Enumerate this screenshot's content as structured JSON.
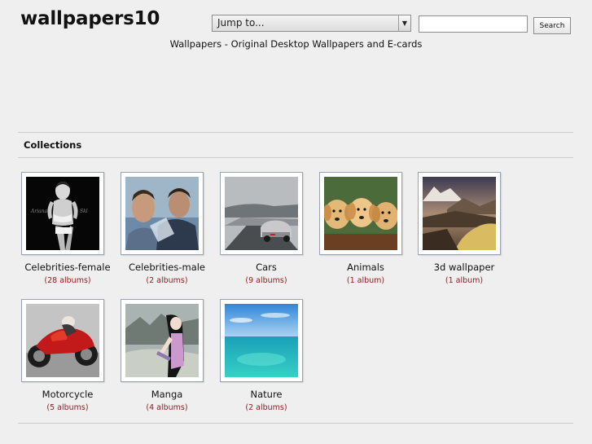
{
  "header": {
    "site_title": "wallpapers10",
    "jump_to": "Jump to...",
    "search_placeholder": "",
    "search_button": "Search",
    "tagline": "Wallpapers - Original Desktop Wallpapers and E-cards"
  },
  "collections": {
    "heading": "Collections",
    "items": [
      {
        "name": "Celebrities-female",
        "count": "(28 albums)"
      },
      {
        "name": "Celebrities-male",
        "count": "(2 albums)"
      },
      {
        "name": "Cars",
        "count": "(9 albums)"
      },
      {
        "name": "Animals",
        "count": "(1 album)"
      },
      {
        "name": "3d wallpaper",
        "count": "(1 album)"
      },
      {
        "name": "Motorcycle",
        "count": "(5 albums)"
      },
      {
        "name": "Manga",
        "count": "(4 albums)"
      },
      {
        "name": "Nature",
        "count": "(2 albums)"
      }
    ]
  },
  "colors": {
    "background": "#efefef",
    "count_text": "#8b1c1c",
    "thumb_border": "#9aa2b2"
  }
}
